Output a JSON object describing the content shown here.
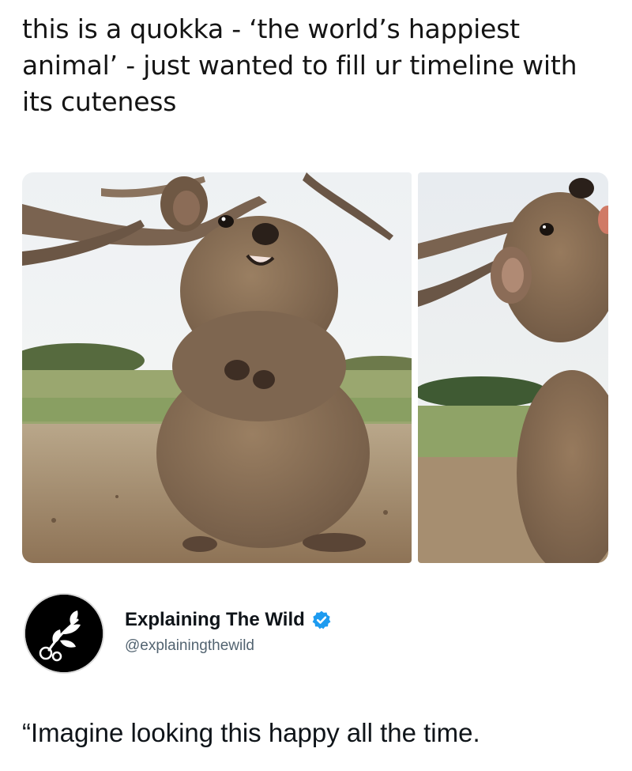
{
  "tweet": {
    "text": "this is a quokka - ‘the world’s happiest animal’ - just wanted to fill ur timeline with its cuteness"
  },
  "media": {
    "photos": [
      {
        "subject": "quokka-smiling-standing"
      },
      {
        "subject": "quokka-eating-side-view"
      }
    ]
  },
  "quoted_account": {
    "display_name": "Explaining The Wild",
    "handle": "@explainingthewild",
    "verified": true,
    "avatar_icon": "leaf-branch-icon",
    "text": "“Imagine looking this happy all the time."
  },
  "colors": {
    "verified_blue": "#1d9bf0",
    "handle_gray": "#536471",
    "text_dark": "#0f1419"
  }
}
